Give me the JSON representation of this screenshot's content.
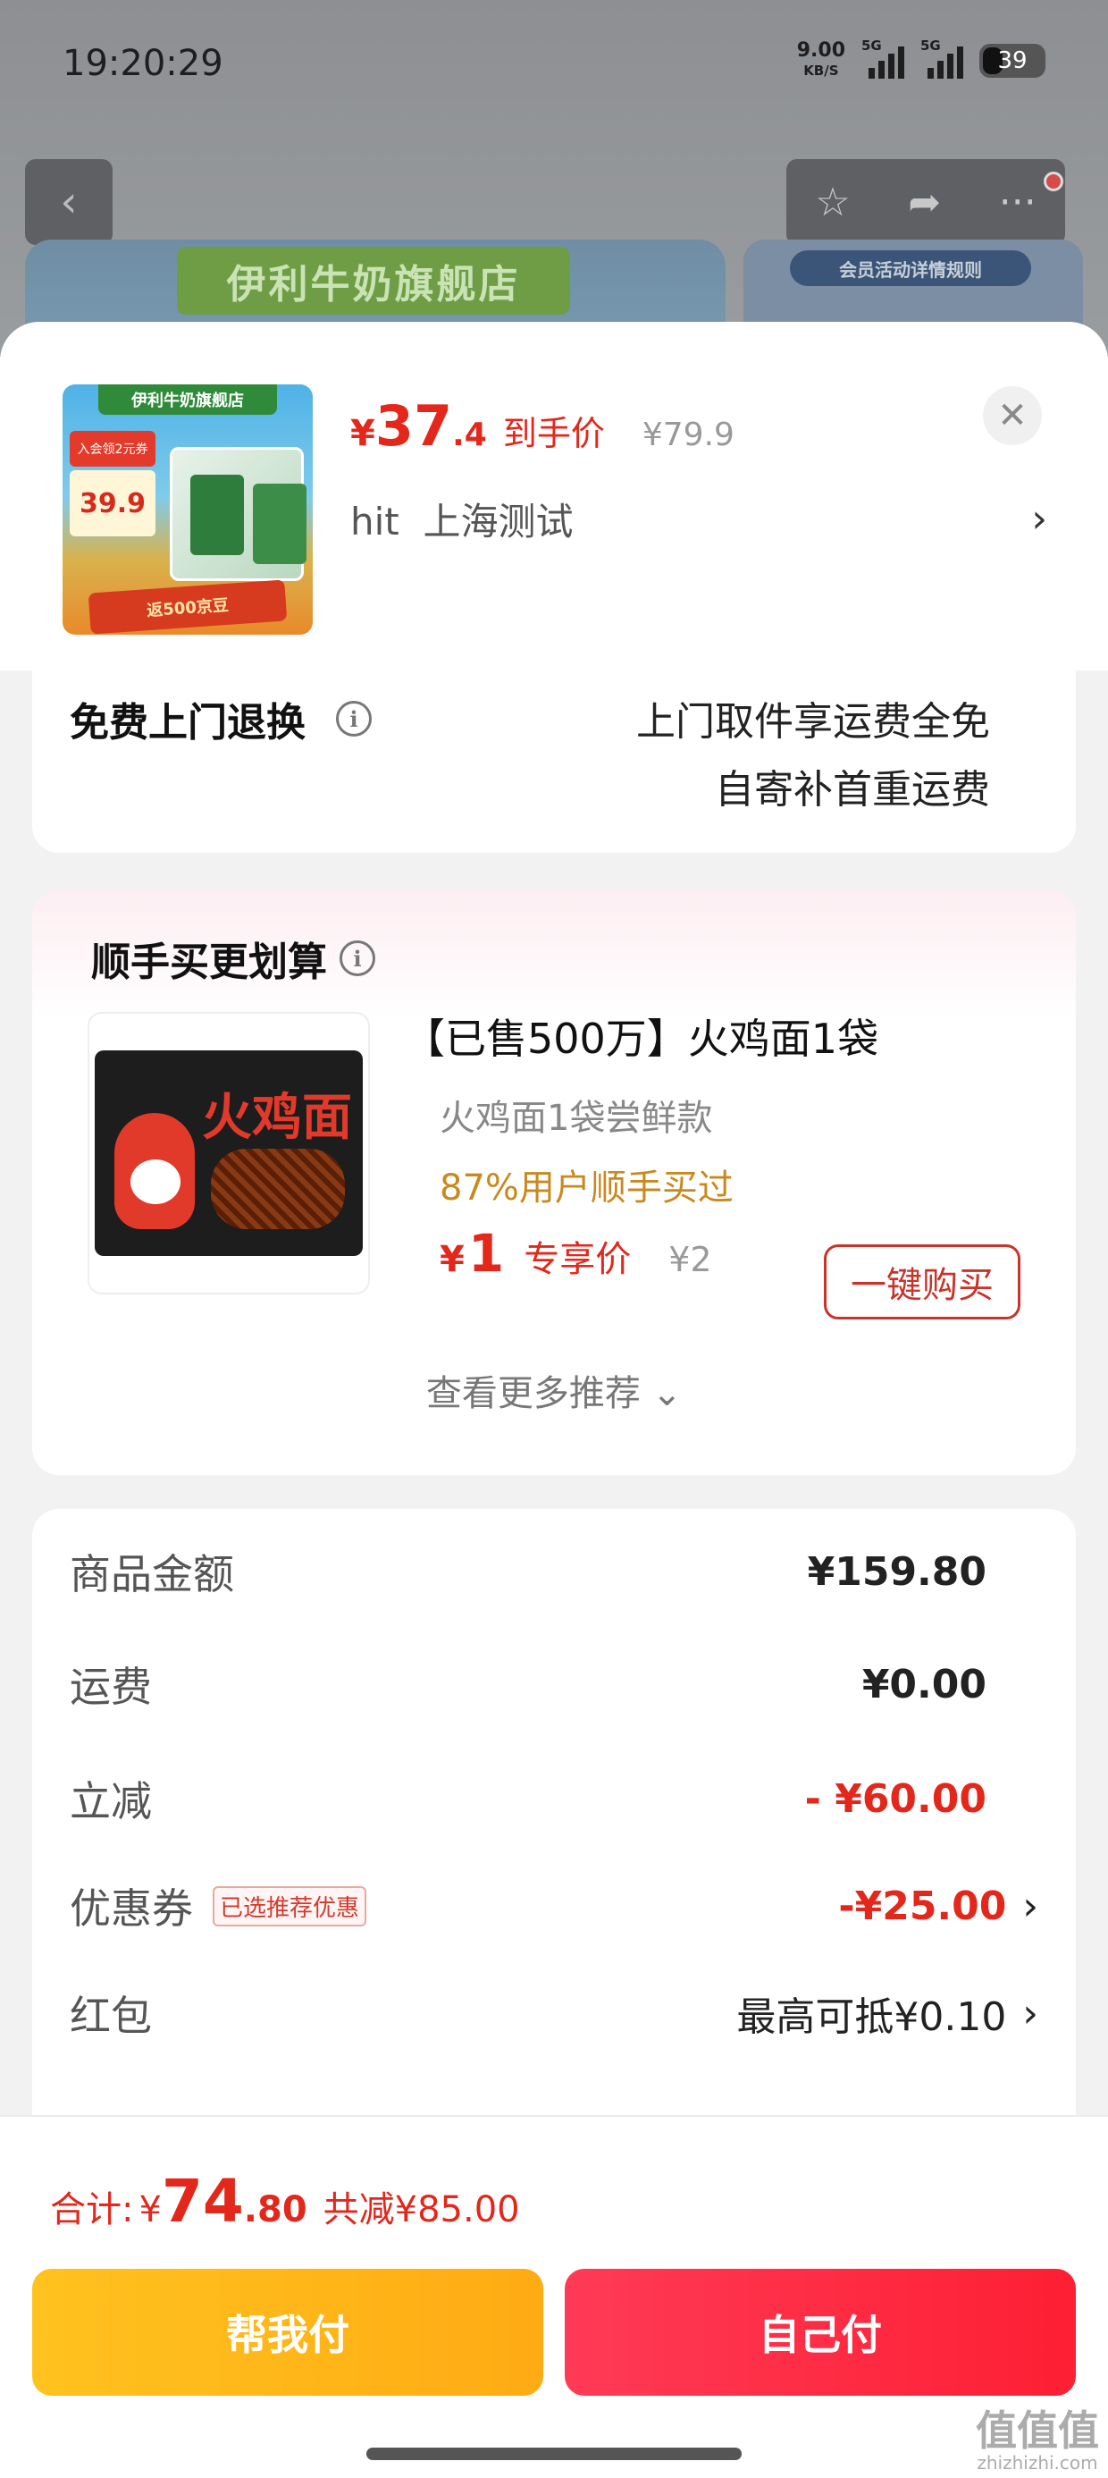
{
  "status_bar": {
    "time": "19:20:29",
    "net_speed": "9.00",
    "net_unit": "KB/S",
    "signal_1": "5G",
    "signal_2": "5G",
    "battery": "39"
  },
  "background": {
    "store_banner": "伊利牛奶旗舰店",
    "side_pill": "会员活动详情规则"
  },
  "product": {
    "currency": "¥",
    "price_int": "37",
    "price_dec": ".4",
    "price_label": "到手价",
    "original_price": "¥79.9",
    "spec": "hit  上海测试",
    "thumb_brand": "伊利牛奶旗舰店",
    "thumb_tag": "入会领2元券",
    "thumb_price": "39.9",
    "thumb_band": "返500京豆"
  },
  "return_service": {
    "title": "免费上门退换",
    "line1": "上门取件享运费全免",
    "line2": "自寄补首重运费"
  },
  "recommend": {
    "title": "顺手买更划算",
    "item_name": "【已售500万】火鸡面1袋",
    "item_sub": "火鸡面1袋尝鲜款",
    "item_hint": "87%用户顺手买过",
    "currency": "¥",
    "price": "1",
    "price_label": "专享价",
    "original_price": "¥2",
    "buy_label": "一键购买",
    "more_label": "查看更多推荐",
    "img_logo": "火鸡面"
  },
  "summary": {
    "rows": [
      {
        "label": "商品金额",
        "value": "¥159.80"
      },
      {
        "label": "运费",
        "value": "¥0.00"
      },
      {
        "label": "立减",
        "value": "- ¥60.00"
      },
      {
        "label": "优惠券",
        "badge": "已选推荐优惠",
        "value": "-¥25.00"
      },
      {
        "label": "红包",
        "value": "最高可抵¥0.10"
      }
    ]
  },
  "footer": {
    "total_label": "合计:",
    "currency": "¥",
    "total_int": "74",
    "total_dec": ".80",
    "total_cut": "共减¥85.00",
    "pay_help": "帮我付",
    "pay_self": "自己付"
  },
  "watermark": {
    "text": "值值值",
    "url": "zhizhizhi.com"
  },
  "colors": {
    "accent_red": "#e3271b",
    "pay_help_yellow": "#ffb81a",
    "pay_self_red": "#fd2a45",
    "hint_orange": "#c88a1e"
  }
}
